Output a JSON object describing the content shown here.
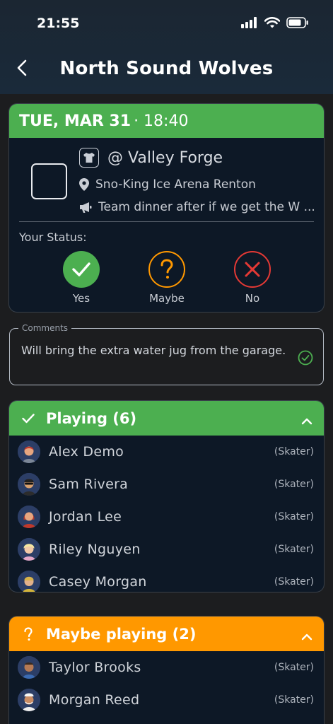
{
  "status_bar": {
    "time": "21:55"
  },
  "header": {
    "title": "North Sound Wolves"
  },
  "event": {
    "date": "TUE, MAR 31",
    "time": "· 18:40",
    "opponent": "@ Valley Forge",
    "location": "Sno-King Ice Arena Renton",
    "note": "Team dinner after if we get the W ...",
    "accent": "#4caf50"
  },
  "rsvp": {
    "label": "Your Status:",
    "options": [
      {
        "label": "Yes",
        "color": "#4caf50",
        "selected": true
      },
      {
        "label": "Maybe",
        "color": "#ff9800",
        "selected": false
      },
      {
        "label": "No",
        "color": "#e53935",
        "selected": false
      }
    ]
  },
  "comments": {
    "legend": "Comments",
    "text": "Will bring the extra water jug from the garage."
  },
  "groups": [
    {
      "title": "Playing (6)",
      "color": "#4caf50",
      "players": [
        {
          "name": "Alex Demo",
          "role": "(Skater)"
        },
        {
          "name": "Sam Rivera",
          "role": "(Skater)"
        },
        {
          "name": "Jordan Lee",
          "role": "(Skater)"
        },
        {
          "name": "Riley Nguyen",
          "role": "(Skater)"
        },
        {
          "name": "Casey Morgan",
          "role": "(Skater)"
        }
      ]
    },
    {
      "title": "Maybe playing (2)",
      "color": "#ff9800",
      "players": [
        {
          "name": "Taylor Brooks",
          "role": "(Skater)"
        },
        {
          "name": "Morgan Reed",
          "role": "(Skater)"
        }
      ]
    }
  ]
}
